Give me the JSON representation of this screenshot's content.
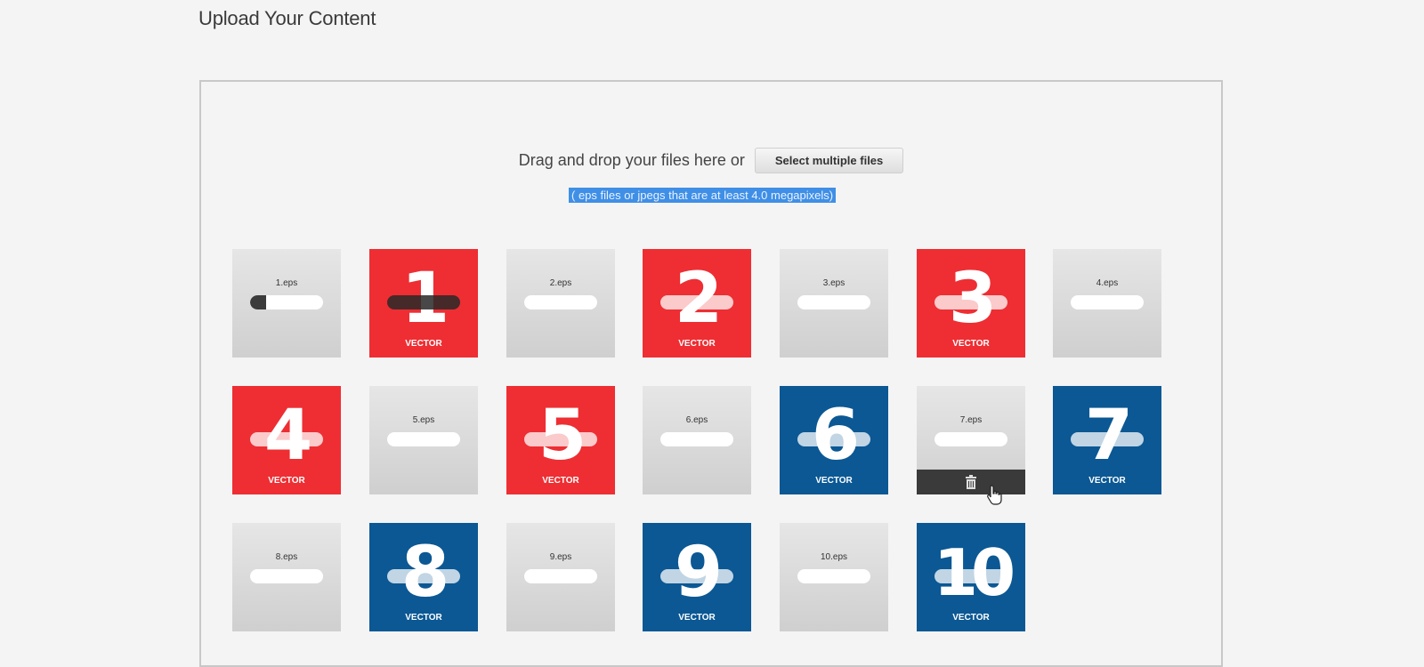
{
  "page": {
    "title": "Upload Your Content"
  },
  "dropzone": {
    "drag_text": "Drag and drop your files here or",
    "select_button": "Select multiple files",
    "hint": "( eps files or jpegs that are at least 4.0 megapixels)"
  },
  "files": [
    {
      "name": "1.eps",
      "progress": 0.22
    },
    {
      "name": "2.eps",
      "progress": 0
    },
    {
      "name": "3.eps",
      "progress": 0
    },
    {
      "name": "4.eps",
      "progress": 0
    },
    {
      "name": "5.eps",
      "progress": 0
    },
    {
      "name": "6.eps",
      "progress": 0
    },
    {
      "name": "7.eps",
      "progress": 0
    },
    {
      "name": "8.eps",
      "progress": 0
    },
    {
      "name": "9.eps",
      "progress": 0
    },
    {
      "name": "10.eps",
      "progress": 0
    }
  ],
  "previews": [
    {
      "number": "1",
      "label": "VECTOR",
      "color": "#ee2e33"
    },
    {
      "number": "2",
      "label": "VECTOR",
      "color": "#ee2e33"
    },
    {
      "number": "3",
      "label": "VECTOR",
      "color": "#ee2e33"
    },
    {
      "number": "4",
      "label": "VECTOR",
      "color": "#ee2e33"
    },
    {
      "number": "5",
      "label": "VECTOR",
      "color": "#ee2e33"
    },
    {
      "number": "6",
      "label": "VECTOR",
      "color": "#0b5894"
    },
    {
      "number": "7",
      "label": "VECTOR",
      "color": "#0b5894"
    },
    {
      "number": "8",
      "label": "VECTOR",
      "color": "#0b5894"
    },
    {
      "number": "9",
      "label": "VECTOR",
      "color": "#0b5894"
    },
    {
      "number": "10",
      "label": "VECTOR",
      "color": "#0b5894"
    }
  ],
  "icons": {
    "delete": "trash-icon",
    "cursor": "hand-cursor-icon"
  }
}
